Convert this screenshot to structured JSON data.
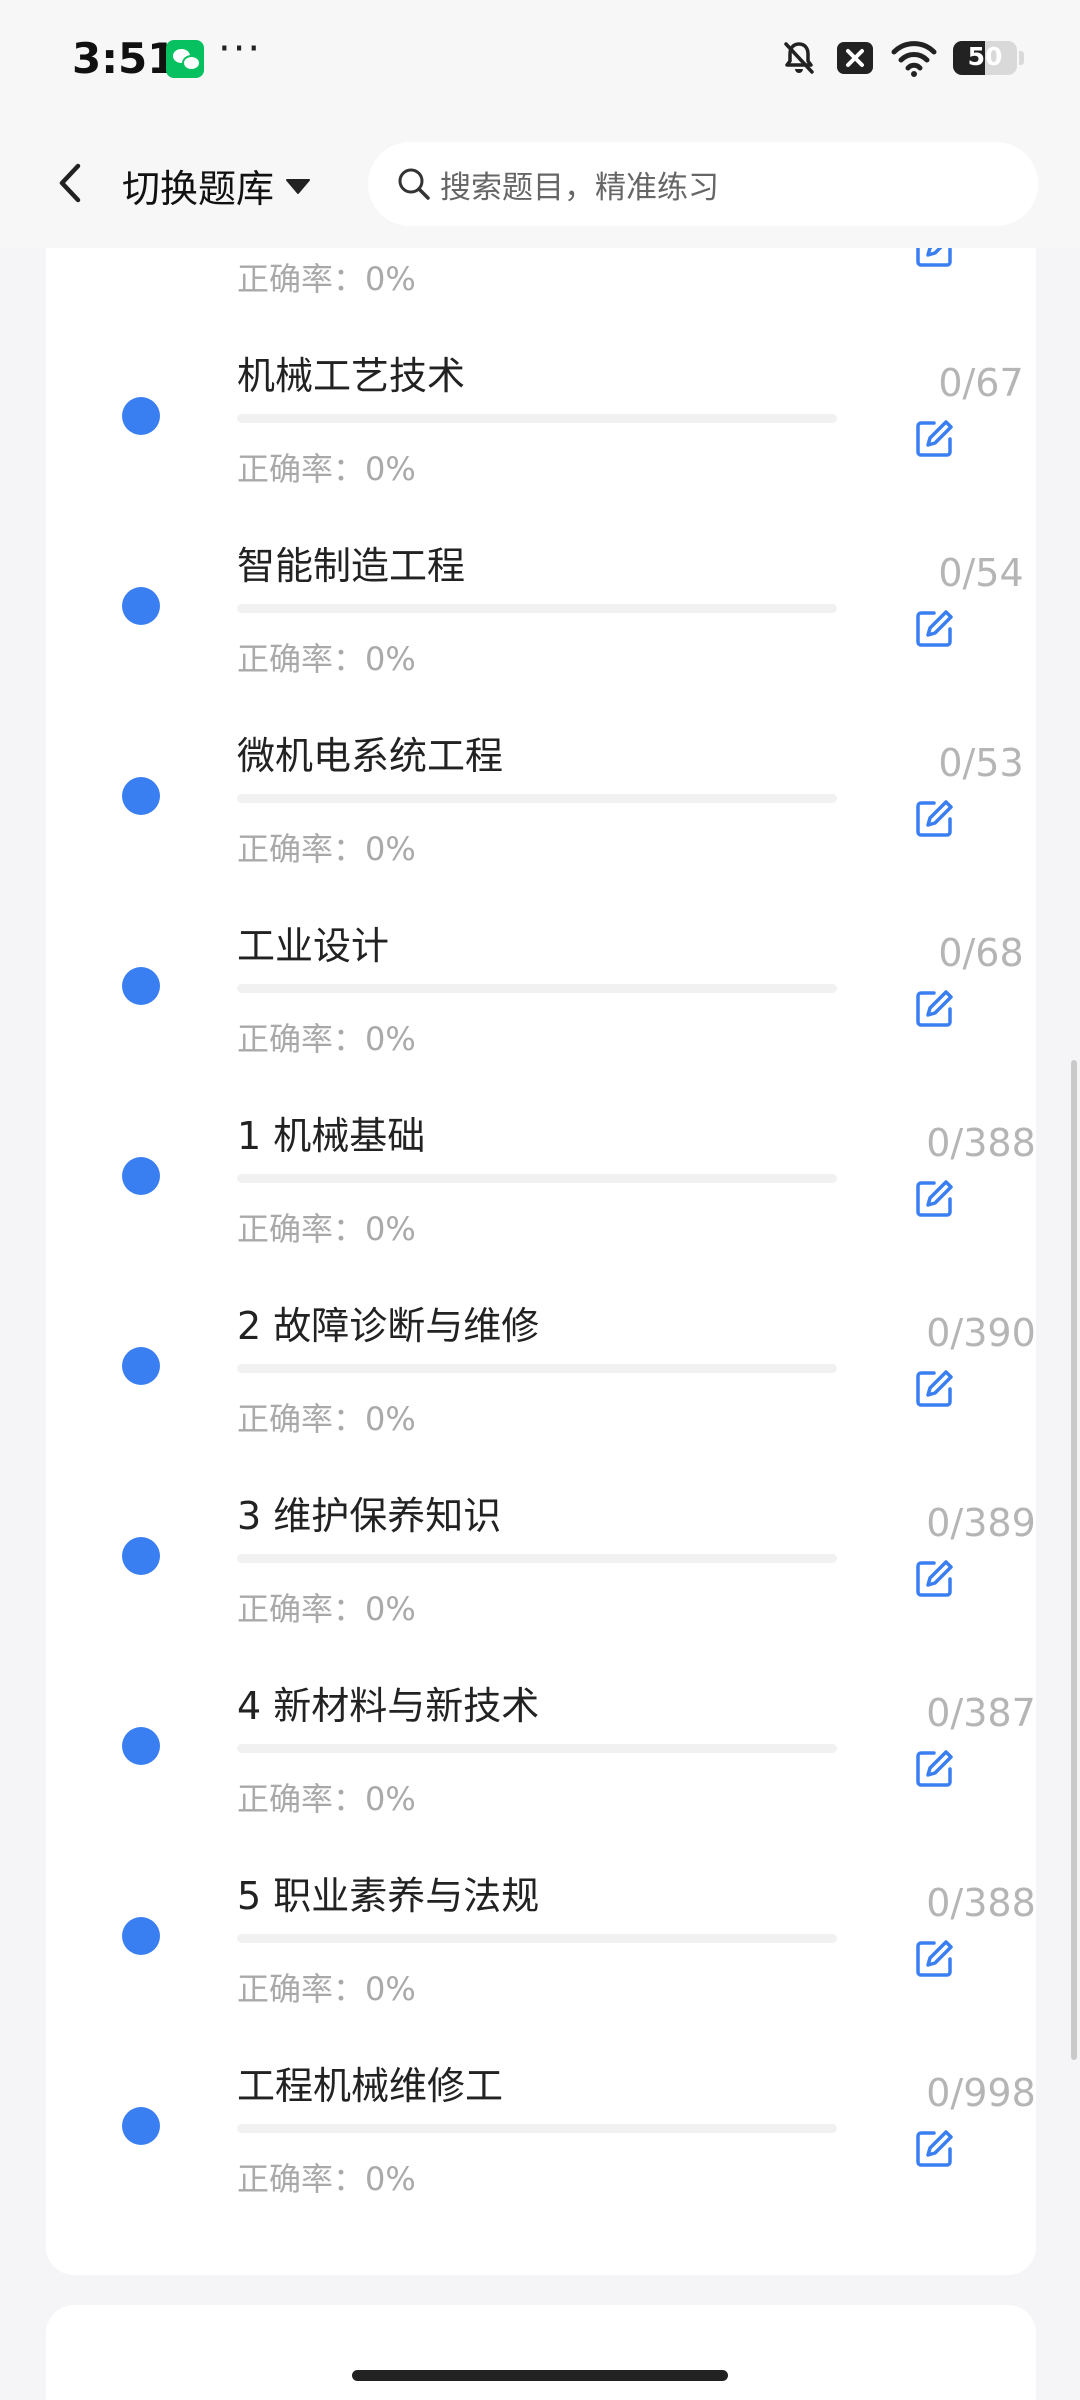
{
  "status_bar": {
    "time": "3:51",
    "dots": "···",
    "battery": "50"
  },
  "header": {
    "bank_switch_label": "切换题库",
    "search_placeholder": "搜索题目，精准练习"
  },
  "list": {
    "accuracy_prefix": "正确率：",
    "items": [
      {
        "title": "",
        "count": "",
        "accuracy": "0%",
        "progress": 0
      },
      {
        "title": "机械工艺技术",
        "count": "0/67",
        "accuracy": "0%",
        "progress": 0
      },
      {
        "title": "智能制造工程",
        "count": "0/54",
        "accuracy": "0%",
        "progress": 0
      },
      {
        "title": "微机电系统工程",
        "count": "0/53",
        "accuracy": "0%",
        "progress": 0
      },
      {
        "title": "工业设计",
        "count": "0/68",
        "accuracy": "0%",
        "progress": 0
      },
      {
        "title": "1 机械基础",
        "count": "0/388",
        "accuracy": "0%",
        "progress": 0
      },
      {
        "title": "2 故障诊断与维修",
        "count": "0/390",
        "accuracy": "0%",
        "progress": 0
      },
      {
        "title": "3 维护保养知识",
        "count": "0/389",
        "accuracy": "0%",
        "progress": 0
      },
      {
        "title": "4 新材料与新技术",
        "count": "0/387",
        "accuracy": "0%",
        "progress": 0
      },
      {
        "title": "5 职业素养与法规",
        "count": "0/388",
        "accuracy": "0%",
        "progress": 0
      },
      {
        "title": "工程机械维修工",
        "count": "0/998",
        "accuracy": "0%",
        "progress": 0
      }
    ]
  },
  "colors": {
    "accent": "#3a7ff2",
    "muted_text": "#a9a9a9",
    "count_text": "#b5b5b5"
  }
}
